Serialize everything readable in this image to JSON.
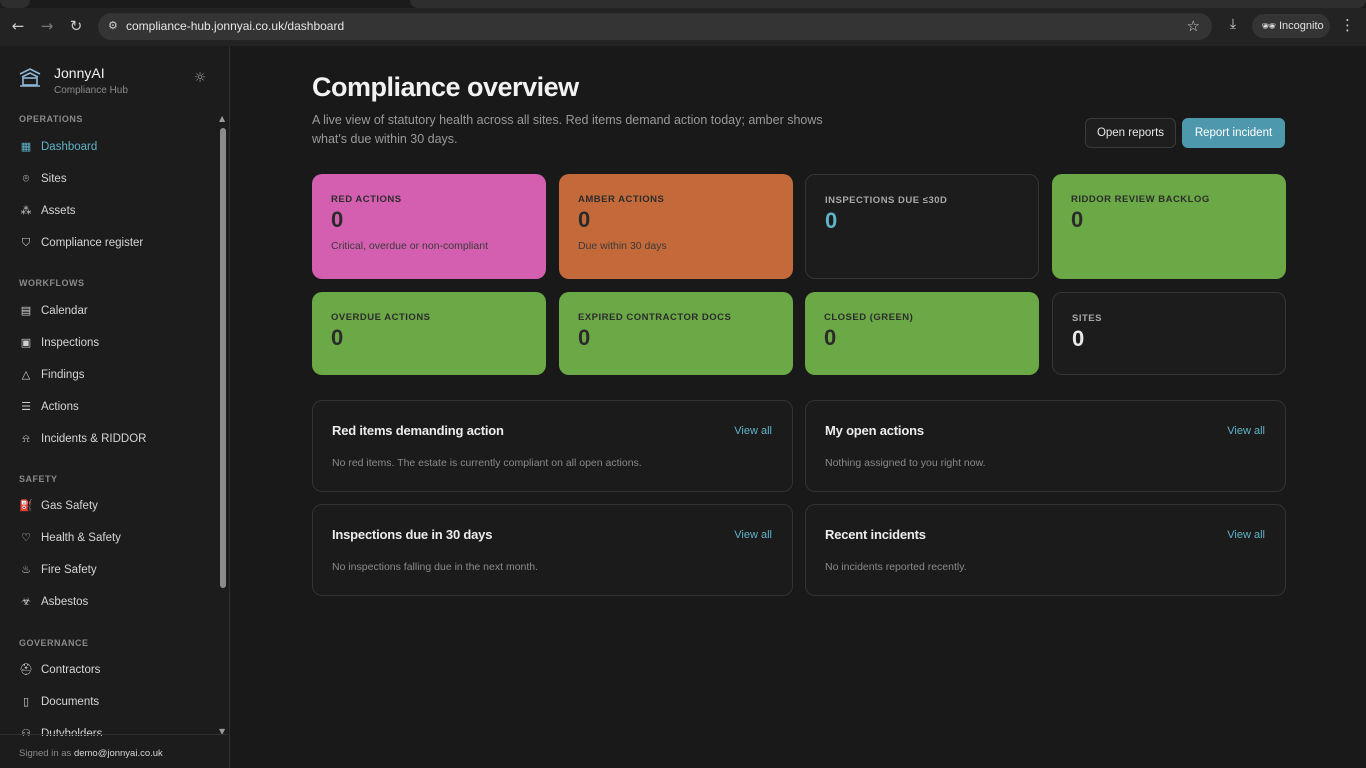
{
  "browser": {
    "url": "compliance-hub.jonnyai.co.uk/dashboard",
    "incognito_label": "Incognito",
    "icons": {
      "back": "back-arrow-icon",
      "forward": "forward-arrow-icon",
      "reload": "reload-icon",
      "site_info": "site-info-icon",
      "bookmark": "star-icon",
      "download": "download-icon",
      "menu": "kebab-menu-icon"
    }
  },
  "sidebar": {
    "brand_name": "JonnyAI",
    "brand_sub": "Compliance Hub",
    "sections": [
      {
        "title": "OPERATIONS",
        "items": [
          {
            "label": "Dashboard",
            "icon": "dashboard-grid-icon",
            "active": true
          },
          {
            "label": "Sites",
            "icon": "map-pin-icon"
          },
          {
            "label": "Assets",
            "icon": "boxes-icon"
          },
          {
            "label": "Compliance register",
            "icon": "shield-check-icon"
          }
        ]
      },
      {
        "title": "WORKFLOWS",
        "items": [
          {
            "label": "Calendar",
            "icon": "calendar-icon"
          },
          {
            "label": "Inspections",
            "icon": "clipboard-icon"
          },
          {
            "label": "Findings",
            "icon": "warning-triangle-icon"
          },
          {
            "label": "Actions",
            "icon": "list-check-icon"
          },
          {
            "label": "Incidents & RIDDOR",
            "icon": "siren-icon"
          }
        ]
      },
      {
        "title": "SAFETY",
        "items": [
          {
            "label": "Gas Safety",
            "icon": "fuel-icon"
          },
          {
            "label": "Health & Safety",
            "icon": "heart-pulse-icon"
          },
          {
            "label": "Fire Safety",
            "icon": "flame-icon"
          },
          {
            "label": "Asbestos",
            "icon": "biohazard-icon"
          }
        ]
      },
      {
        "title": "GOVERNANCE",
        "items": [
          {
            "label": "Contractors",
            "icon": "hard-hat-icon"
          },
          {
            "label": "Documents",
            "icon": "document-icon"
          },
          {
            "label": "Dutyholders",
            "icon": "users-icon"
          }
        ]
      }
    ],
    "signed_in_prefix": "Signed in as ",
    "signed_in_email": "demo@jonnyai.co.uk"
  },
  "header": {
    "title": "Compliance overview",
    "subtitle": "A live view of statutory health across all sites. Red items demand action today; amber shows what's due within 30 days.",
    "open_reports": "Open reports",
    "report_incident": "Report incident"
  },
  "kpis": [
    {
      "label": "RED ACTIONS",
      "value": "0",
      "sub": "Critical, overdue or non-compliant",
      "color": "#d45fb0"
    },
    {
      "label": "AMBER ACTIONS",
      "value": "0",
      "sub": "Due within 30 days",
      "color": "#c4693a"
    },
    {
      "label": "INSPECTIONS DUE ≤30D",
      "value": "0",
      "sub": "",
      "color": "#1c1c1c",
      "value_color": "#5fb3c8"
    },
    {
      "label": "RIDDOR REVIEW BACKLOG",
      "value": "0",
      "sub": "",
      "color": "#6ba846"
    },
    {
      "label": "OVERDUE ACTIONS",
      "value": "0",
      "sub": "",
      "color": "#6ba846"
    },
    {
      "label": "EXPIRED CONTRACTOR DOCS",
      "value": "0",
      "sub": "",
      "color": "#6ba846"
    },
    {
      "label": "CLOSED (GREEN)",
      "value": "0",
      "sub": "",
      "color": "#6ba846"
    },
    {
      "label": "SITES",
      "value": "0",
      "sub": "",
      "color": "#1c1c1c"
    }
  ],
  "panels": [
    {
      "title": "Red items demanding action",
      "link": "View all",
      "empty": "No red items. The estate is currently compliant on all open actions."
    },
    {
      "title": "My open actions",
      "link": "View all",
      "empty": "Nothing assigned to you right now."
    },
    {
      "title": "Inspections due in 30 days",
      "link": "View all",
      "empty": "No inspections falling due in the next month."
    },
    {
      "title": "Recent incidents",
      "link": "View all",
      "empty": "No incidents reported recently."
    }
  ]
}
